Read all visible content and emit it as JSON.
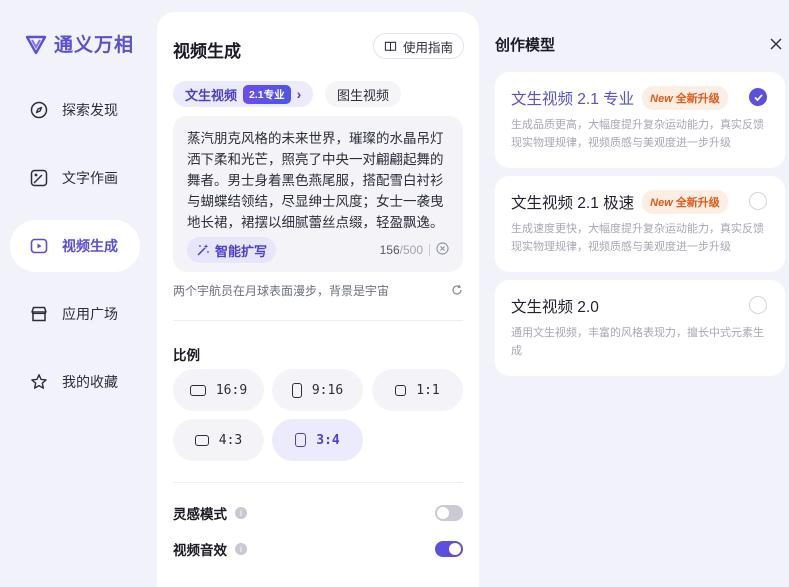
{
  "app": {
    "logo_text": "通义万相"
  },
  "sidebar": {
    "items": [
      {
        "label": "探索发现",
        "icon": "compass-icon",
        "active": false
      },
      {
        "label": "文字作画",
        "icon": "image-edit-icon",
        "active": false
      },
      {
        "label": "视频生成",
        "icon": "video-play-icon",
        "active": true
      },
      {
        "label": "应用广场",
        "icon": "store-icon",
        "active": false
      },
      {
        "label": "我的收藏",
        "icon": "star-icon",
        "active": false
      }
    ]
  },
  "panel": {
    "title": "视频生成",
    "guide_label": "使用指南",
    "tabs": {
      "text_to_video": "文生视频",
      "version_badge": "2.1专业",
      "image_to_video": "图生视频"
    },
    "prompt": {
      "text": "蒸汽朋克风格的未来世界，璀璨的水晶吊灯洒下柔和光芒，照亮了中央一对翩翩起舞的舞者。男士身着黑色燕尾服，搭配雪白衬衫与蝴蝶结领结，尽显绅士风度；女士一袭曳地长裙，裙摆以细腻蕾丝点缀，轻盈飘逸。他们紧",
      "expand_label": "智能扩写",
      "count": "156",
      "max": "/500"
    },
    "suggestion": "两个宇航员在月球表面漫步，背景是宇宙",
    "ratio_label": "比例",
    "ratios": [
      {
        "label": "16:9",
        "active": false
      },
      {
        "label": "9:16",
        "active": false
      },
      {
        "label": "1:1",
        "active": false
      },
      {
        "label": "4:3",
        "active": false
      },
      {
        "label": "3:4",
        "active": true
      }
    ],
    "toggles": [
      {
        "label": "灵感模式",
        "on": false
      },
      {
        "label": "视频音效",
        "on": true
      }
    ]
  },
  "models": {
    "title": "创作模型",
    "items": [
      {
        "name": "文生视频 2.1 专业",
        "badge_new": "New",
        "badge_text": "全新升级",
        "desc": "生成品质更高，大幅度提升复杂运动能力，真实反馈现实物理规律，视频质感与美观度进一步升级",
        "selected": true
      },
      {
        "name": "文生视频 2.1 极速",
        "badge_new": "New",
        "badge_text": "全新升级",
        "desc": "生成速度更快，大幅度提升复杂运动能力，真实反馈现实物理规律，视频质感与美观度进一步升级",
        "selected": false
      },
      {
        "name": "文生视频 2.0",
        "badge_new": "",
        "badge_text": "",
        "desc": "通用文生视频，丰富的风格表现力，擅长中式元素生成",
        "selected": false
      }
    ]
  },
  "colors": {
    "accent": "#5b4fe0",
    "brand": "#5a4fd8",
    "badge_orange": "#e05a1a"
  }
}
